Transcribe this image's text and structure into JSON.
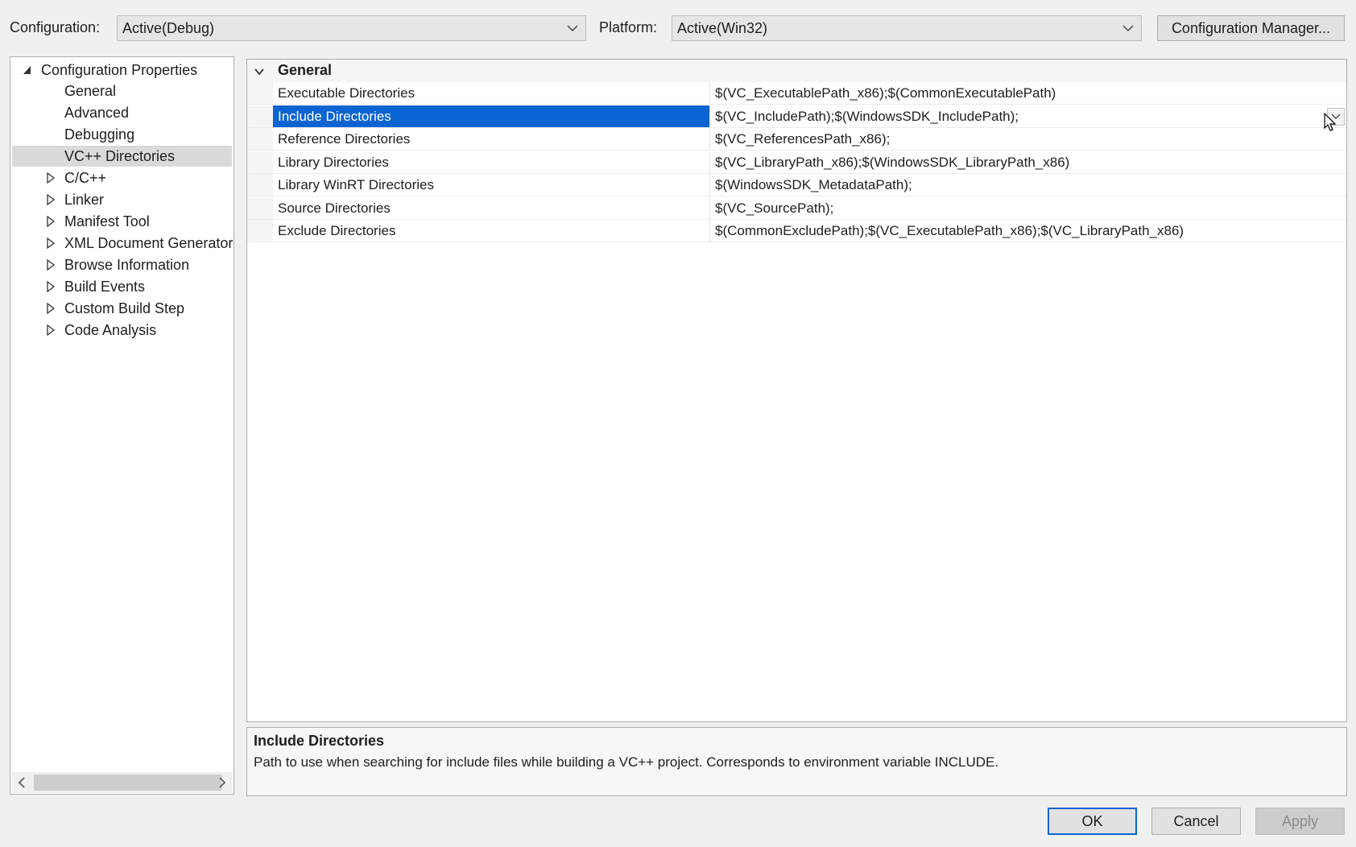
{
  "toolbar": {
    "configuration_label": "Configuration:",
    "configuration_value": "Active(Debug)",
    "platform_label": "Platform:",
    "platform_value": "Active(Win32)",
    "config_manager_button": "Configuration Manager..."
  },
  "tree": {
    "root": "Configuration Properties",
    "items": [
      {
        "label": "General",
        "expandable": false,
        "selected": false
      },
      {
        "label": "Advanced",
        "expandable": false,
        "selected": false
      },
      {
        "label": "Debugging",
        "expandable": false,
        "selected": false
      },
      {
        "label": "VC++ Directories",
        "expandable": false,
        "selected": true
      },
      {
        "label": "C/C++",
        "expandable": true,
        "selected": false
      },
      {
        "label": "Linker",
        "expandable": true,
        "selected": false
      },
      {
        "label": "Manifest Tool",
        "expandable": true,
        "selected": false
      },
      {
        "label": "XML Document Generator",
        "expandable": true,
        "selected": false
      },
      {
        "label": "Browse Information",
        "expandable": true,
        "selected": false
      },
      {
        "label": "Build Events",
        "expandable": true,
        "selected": false
      },
      {
        "label": "Custom Build Step",
        "expandable": true,
        "selected": false
      },
      {
        "label": "Code Analysis",
        "expandable": true,
        "selected": false
      }
    ]
  },
  "grid": {
    "category": "General",
    "properties": [
      {
        "name": "Executable Directories",
        "value": "$(VC_ExecutablePath_x86);$(CommonExecutablePath)",
        "selected": false
      },
      {
        "name": "Include Directories",
        "value": "$(VC_IncludePath);$(WindowsSDK_IncludePath);",
        "selected": true
      },
      {
        "name": "Reference Directories",
        "value": "$(VC_ReferencesPath_x86);",
        "selected": false
      },
      {
        "name": "Library Directories",
        "value": "$(VC_LibraryPath_x86);$(WindowsSDK_LibraryPath_x86)",
        "selected": false
      },
      {
        "name": "Library WinRT Directories",
        "value": "$(WindowsSDK_MetadataPath);",
        "selected": false
      },
      {
        "name": "Source Directories",
        "value": "$(VC_SourcePath);",
        "selected": false
      },
      {
        "name": "Exclude Directories",
        "value": "$(CommonExcludePath);$(VC_ExecutablePath_x86);$(VC_LibraryPath_x86)",
        "selected": false
      }
    ]
  },
  "description": {
    "title": "Include Directories",
    "text": "Path to use when searching for include files while building a VC++ project.  Corresponds to environment variable INCLUDE."
  },
  "buttons": {
    "ok": "OK",
    "cancel": "Cancel",
    "apply": "Apply"
  },
  "colors": {
    "selection": "#0a64d2",
    "tree_selection": "#dadada",
    "default_button_border": "#0a64d2"
  }
}
